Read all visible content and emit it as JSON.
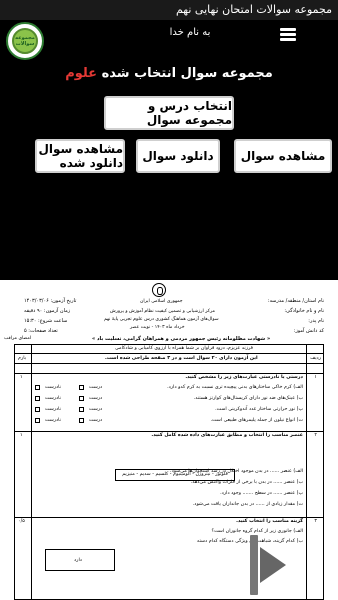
{
  "app": {
    "title": "مجموعه سوالات امتحان نهایی نهم"
  },
  "header": {
    "basmala": "به نام خدا",
    "logo_text": "مجموعه سوالات"
  },
  "main": {
    "title_prefix": "مجموعه سوال انتخاب شده ",
    "title_accent": "علوم",
    "select_button": "انتخاب درس و مجموعه سوال",
    "view_button": "مشاهده سوال",
    "download_button": "دانلود سوال",
    "view_downloaded_button": "مشاهده سوال  دانلود شده"
  },
  "colors": {
    "accent": "#e53935",
    "background": "#000000",
    "button_bg": "#ffffff"
  },
  "doc": {
    "right_col_1": "نام استان/ منطقه/ مدرسه:",
    "right_col_2": "نام و نام خانوادگی:",
    "right_col_3": "نام پدر:",
    "right_col_4": "کد دانش آموز:",
    "left_col_1": "تاریخ آزمون: ۱۴۰۳/۰۳/۰۶",
    "left_col_2": "زمان آزمون: ۹۰ دقیقه",
    "left_col_3": "ساعت شروع: ۱۵:۳۰",
    "left_col_4": "تعداد صفحات: ۵",
    "center_1": "مرکز ارزشیابی و تضمین کیفیت نظام آموزش و پرورش",
    "center_2": "سوال‌های آزمون هماهنگ کشوری درس علوم تجربی پایهٔ نهم",
    "center_3": "خرداد ماه ۱۴۰۳ - نوبت عصر",
    "seal_text": "جمهوری اسلامی ایران",
    "slogan": "« شهادت مظلومانه رئیس جمهور مردمی و همراهان گرامی، تسلیت باد »",
    "notice": "فرزند عزیزم، درود فراوان بر شما همراه با آرزوی کامیابی و شادکامی",
    "exam_info": "این آزمون دارای ۲۰ سوال است و در ۳ صفحه طراحی شده است.",
    "proctor": "امضای مراقب",
    "col_row": "ردیف",
    "col_score": "بارم",
    "q1_title": "درستی یا نادرستی عبارت‌های زیر را مشخص کنید.",
    "q1_a": "الف) کرم خاکی ساختار‌های بدنی پیچیده تری نسبت به کرم کدو دارد.",
    "q1_b": "ب) عینک‌های ضد نور دارای کریستال‌های کوارتز هستند.",
    "q1_c": "پ) نور حرارتی ساختار غدد آندوکرینی است.",
    "q1_d": "ت) انواع نیلون از جمله پلیمرهای طبیعی است.",
    "q2_title": "عنصر مناسب را انتخاب و مطابق عبارت‌های داده شده کامل کنید.",
    "q2_chain": "فلوئور - نیتروژن - آلومینیوم - کلسیم - سدیم - منیزیم",
    "q2_a": "الف) عنصر ...... در بدن موجود اختلال در رشد استخوان‌ها می‌شود.",
    "q2_b": "ب) عنصر ...... در بدن با برخی از فلزات واکنش می‌دهد.",
    "q2_c": "پ) عنصر ...... در سطح ....... وجود دارد.",
    "q2_d": "ت) مقدار زیادی از ...... در بدن جانداران یافت می‌شود.",
    "q3_title": "گزینه مناسب را انتخاب کنید.",
    "q3_a": "الف) جانوری زیر از کدام گروه جانوران است؟",
    "q3_b": "ب) کدام گزینه، شباهت‌های ویژگی دستگاه کدام دسته",
    "q3_img_label": "دارد",
    "true_label": "درست",
    "false_label": "نادرست",
    "score_1": "۱",
    "score_2": "۱",
    "score_3": "۰/۵",
    "row_1": "۱",
    "row_2": "۲",
    "row_3": "۳"
  }
}
